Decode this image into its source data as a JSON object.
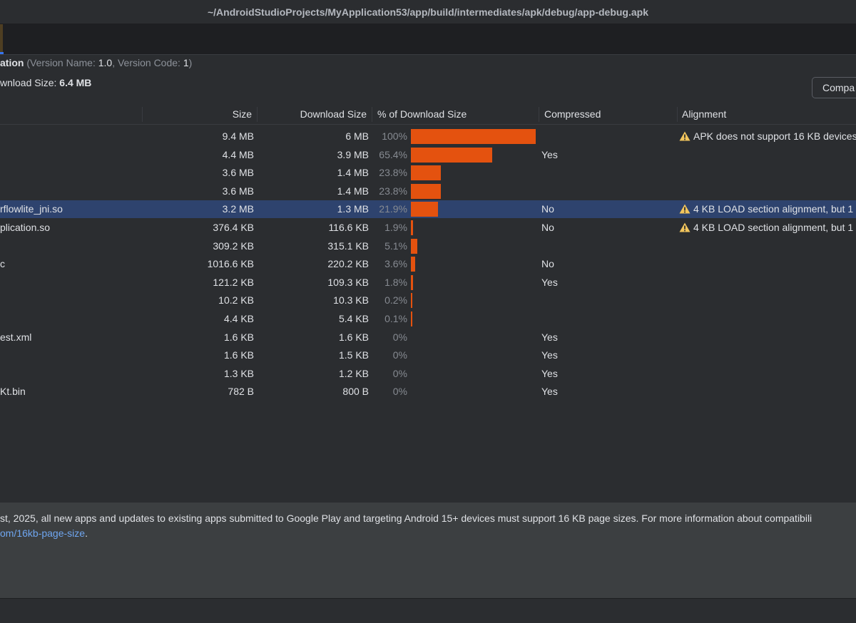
{
  "window": {
    "title": "~/AndroidStudioProjects/MyApplication53/app/build/intermediates/apk/debug/app-debug.apk"
  },
  "summary": {
    "app_name_fragment": "ation",
    "version_name_label": "Version Name:",
    "version_name": "1.0",
    "version_code_label": "Version Code:",
    "version_code": "1",
    "download_size_label": "wnload Size:",
    "download_size": "6.4 MB",
    "compare_button": "Compa"
  },
  "table": {
    "columns": [
      "Size",
      "Download Size",
      "% of Download Size",
      "Compressed",
      "Alignment"
    ],
    "rows": [
      {
        "name": "",
        "size": "9.4 MB",
        "download": "6 MB",
        "pct": "100%",
        "pct_value": 100,
        "compressed": "",
        "alignment": "APK does not support 16 KB devices",
        "warn": true,
        "selected": false
      },
      {
        "name": "",
        "size": "4.4 MB",
        "download": "3.9 MB",
        "pct": "65.4%",
        "pct_value": 65.4,
        "compressed": "Yes",
        "alignment": "",
        "warn": false,
        "selected": false
      },
      {
        "name": "",
        "size": "3.6 MB",
        "download": "1.4 MB",
        "pct": "23.8%",
        "pct_value": 23.8,
        "compressed": "",
        "alignment": "",
        "warn": false,
        "selected": false
      },
      {
        "name": "",
        "size": "3.6 MB",
        "download": "1.4 MB",
        "pct": "23.8%",
        "pct_value": 23.8,
        "compressed": "",
        "alignment": "",
        "warn": false,
        "selected": false
      },
      {
        "name": "rflowlite_jni.so",
        "size": "3.2 MB",
        "download": "1.3 MB",
        "pct": "21.9%",
        "pct_value": 21.9,
        "compressed": "No",
        "alignment": "4 KB LOAD section alignment, but 1",
        "warn": true,
        "selected": true
      },
      {
        "name": "plication.so",
        "size": "376.4 KB",
        "download": "116.6 KB",
        "pct": "1.9%",
        "pct_value": 1.9,
        "compressed": "No",
        "alignment": "4 KB LOAD section alignment, but 1",
        "warn": true,
        "selected": false
      },
      {
        "name": "",
        "size": "309.2 KB",
        "download": "315.1 KB",
        "pct": "5.1%",
        "pct_value": 5.1,
        "compressed": "",
        "alignment": "",
        "warn": false,
        "selected": false
      },
      {
        "name": "c",
        "size": "1016.6 KB",
        "download": "220.2 KB",
        "pct": "3.6%",
        "pct_value": 3.6,
        "compressed": "No",
        "alignment": "",
        "warn": false,
        "selected": false
      },
      {
        "name": "",
        "size": "121.2 KB",
        "download": "109.3 KB",
        "pct": "1.8%",
        "pct_value": 1.8,
        "compressed": "Yes",
        "alignment": "",
        "warn": false,
        "selected": false
      },
      {
        "name": "",
        "size": "10.2 KB",
        "download": "10.3 KB",
        "pct": "0.2%",
        "pct_value": 0.2,
        "compressed": "",
        "alignment": "",
        "warn": false,
        "selected": false
      },
      {
        "name": "",
        "size": "4.4 KB",
        "download": "5.4 KB",
        "pct": "0.1%",
        "pct_value": 0.1,
        "compressed": "",
        "alignment": "",
        "warn": false,
        "selected": false
      },
      {
        "name": "est.xml",
        "size": "1.6 KB",
        "download": "1.6 KB",
        "pct": "0%",
        "pct_value": 0,
        "compressed": "Yes",
        "alignment": "",
        "warn": false,
        "selected": false
      },
      {
        "name": "",
        "size": "1.6 KB",
        "download": "1.5 KB",
        "pct": "0%",
        "pct_value": 0,
        "compressed": "Yes",
        "alignment": "",
        "warn": false,
        "selected": false
      },
      {
        "name": "",
        "size": "1.3 KB",
        "download": "1.2 KB",
        "pct": "0%",
        "pct_value": 0,
        "compressed": "Yes",
        "alignment": "",
        "warn": false,
        "selected": false
      },
      {
        "name": "Kt.bin",
        "size": "782 B",
        "download": "800 B",
        "pct": "0%",
        "pct_value": 0,
        "compressed": "Yes",
        "alignment": "",
        "warn": false,
        "selected": false
      }
    ]
  },
  "notice": {
    "line1": "st, 2025, all new apps and updates to existing apps submitted to Google Play and targeting Android 15+ devices must support 16 KB page sizes. For more information about compatibili",
    "link": "om/16kb-page-size",
    "line2_suffix": "."
  },
  "colors": {
    "bar": "#e4520f",
    "selected_row": "#2e436e",
    "link": "#6fa6f0",
    "warning": "#f2c55c"
  }
}
